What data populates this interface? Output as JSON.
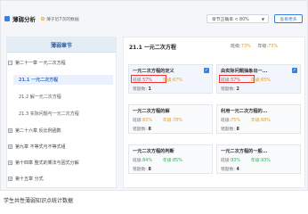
{
  "header": {
    "title": "薄弱分析",
    "note": "薄于近7次的数据",
    "select_label": "章节正确率 < 80%",
    "more_button": "查看更多"
  },
  "sidebar": {
    "head": "薄弱章节",
    "chapters": [
      {
        "label": "第二十一章 一元二次方程",
        "expanded": true
      },
      {
        "label": "第二十六章 反比例函数",
        "expanded": false
      },
      {
        "label": "第九章 不等式与不等式组",
        "expanded": false
      },
      {
        "label": "第十四章 整式的乘法与因式分解",
        "expanded": false
      },
      {
        "label": "第十五章 分式",
        "expanded": false
      }
    ],
    "sections": [
      "21.1 一元二次方程",
      "21.2 解一元二次方程",
      "21.3 实际问题与一元二次方程"
    ]
  },
  "main": {
    "section_title": "21.1 一元二次方程",
    "class_rate_label": "班级:",
    "class_rate": "73%",
    "grade_rate_label": "年级:",
    "grade_rate": "73%",
    "cards": [
      {
        "title": "一元二次方程的定义",
        "class_label": "班级:",
        "class_rate": "57%",
        "grade_label": "年级:",
        "grade_rate": "67%",
        "wrong_label": "错题数:",
        "wrong_count": "1",
        "checked": true,
        "flagged": true
      },
      {
        "title": "由实际问题抽象出一...",
        "class_label": "班级:",
        "class_rate": "57%",
        "grade_label": "年级:",
        "grade_rate": "65%",
        "wrong_label": "错题数:",
        "wrong_count": "2",
        "checked": true,
        "flagged": true
      },
      {
        "title": "一元二次方程的解",
        "class_label": "班级:",
        "class_rate": "65%",
        "grade_label": "年级:",
        "grade_rate": "78%",
        "wrong_label": "错题数:",
        "wrong_count": "8",
        "checked": false,
        "flagged": false
      },
      {
        "title": "利用一元二次方程的...",
        "class_label": "班级:",
        "class_rate": "75%",
        "grade_label": "年级:",
        "grade_rate": "68%",
        "wrong_label": "错题数:",
        "wrong_count": "8",
        "checked": false,
        "flagged": false
      },
      {
        "title": "一元二次方程的判断",
        "class_label": "班级:",
        "class_rate": "84%",
        "grade_label": "年级:",
        "grade_rate": "85%",
        "wrong_label": "错题数:",
        "wrong_count": "8",
        "checked": false,
        "flagged": false
      },
      {
        "title": "一元二次方程的一般...",
        "class_label": "班级:",
        "class_rate": "93%",
        "grade_label": "年级:",
        "grade_rate": "93%",
        "wrong_label": "错题数:",
        "wrong_count": "4",
        "checked": false,
        "flagged": false
      }
    ]
  },
  "caption": "学生共性薄弱知识点统计数据",
  "colors": {
    "accent": "#3a7fde",
    "warn": "#e39a1a",
    "bad": "#e33333",
    "good": "#2fae5b"
  }
}
